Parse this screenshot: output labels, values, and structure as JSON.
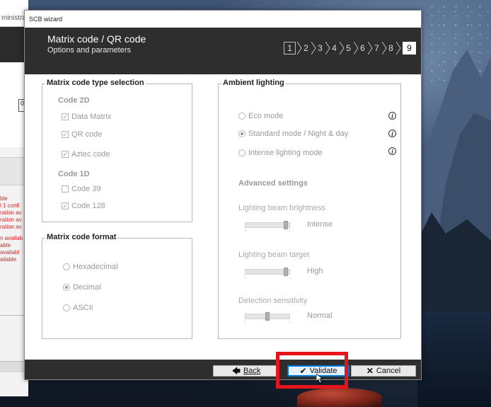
{
  "background_app": {
    "title_fragment": "ministra",
    "field_fragment": "0",
    "red_messages": [
      "ble",
      "l 1 confi",
      "ration av",
      "ration av",
      "ration av",
      "n availab",
      "able",
      " availabl",
      "ailable"
    ]
  },
  "wizard": {
    "window_title": "SCB wizard",
    "header_title": "Matrix code / QR code",
    "header_subtitle": "Options and parameters",
    "steps": [
      "1",
      "2",
      "3",
      "4",
      "5",
      "6",
      "7",
      "8",
      "9"
    ],
    "current_step": "9"
  },
  "matrix_type": {
    "title": "Matrix code type selection",
    "code2d_label": "Code 2D",
    "code2d_options": [
      {
        "label": "Data Matrix",
        "checked": true
      },
      {
        "label": "QR code",
        "checked": true
      },
      {
        "label": "Aztec code",
        "checked": true
      }
    ],
    "code1d_label": "Code 1D",
    "code1d_options": [
      {
        "label": "Code 39",
        "checked": false
      },
      {
        "label": "Code 128",
        "checked": true
      }
    ]
  },
  "matrix_format": {
    "title": "Matrix code format",
    "options": [
      {
        "label": "Hexadecimal",
        "selected": false
      },
      {
        "label": "Decimal",
        "selected": true
      },
      {
        "label": "ASCII",
        "selected": false
      }
    ]
  },
  "ambient": {
    "title": "Ambient lighting",
    "modes": [
      {
        "label": "Eco mode",
        "selected": false
      },
      {
        "label": "Standard mode / Night & day",
        "selected": true
      },
      {
        "label": "Intense lighting mode",
        "selected": false
      }
    ],
    "info_glyph": "i",
    "advanced_label": "Advanced settings",
    "settings": [
      {
        "label": "Lighting beam brightness",
        "value_text": "Intense",
        "level": 0.95
      },
      {
        "label": "Lighting beam target",
        "value_text": "High",
        "level": 0.95
      },
      {
        "label": "Detection sensitivity",
        "value_text": "Normal",
        "level": 0.5
      }
    ]
  },
  "footer": {
    "back_label": "Back",
    "validate_label": "Validate",
    "cancel_label": "Cancel"
  },
  "colors": {
    "highlight": "#e8141b",
    "header_bg": "#2e2e2e",
    "primary_border": "#0078d7"
  }
}
